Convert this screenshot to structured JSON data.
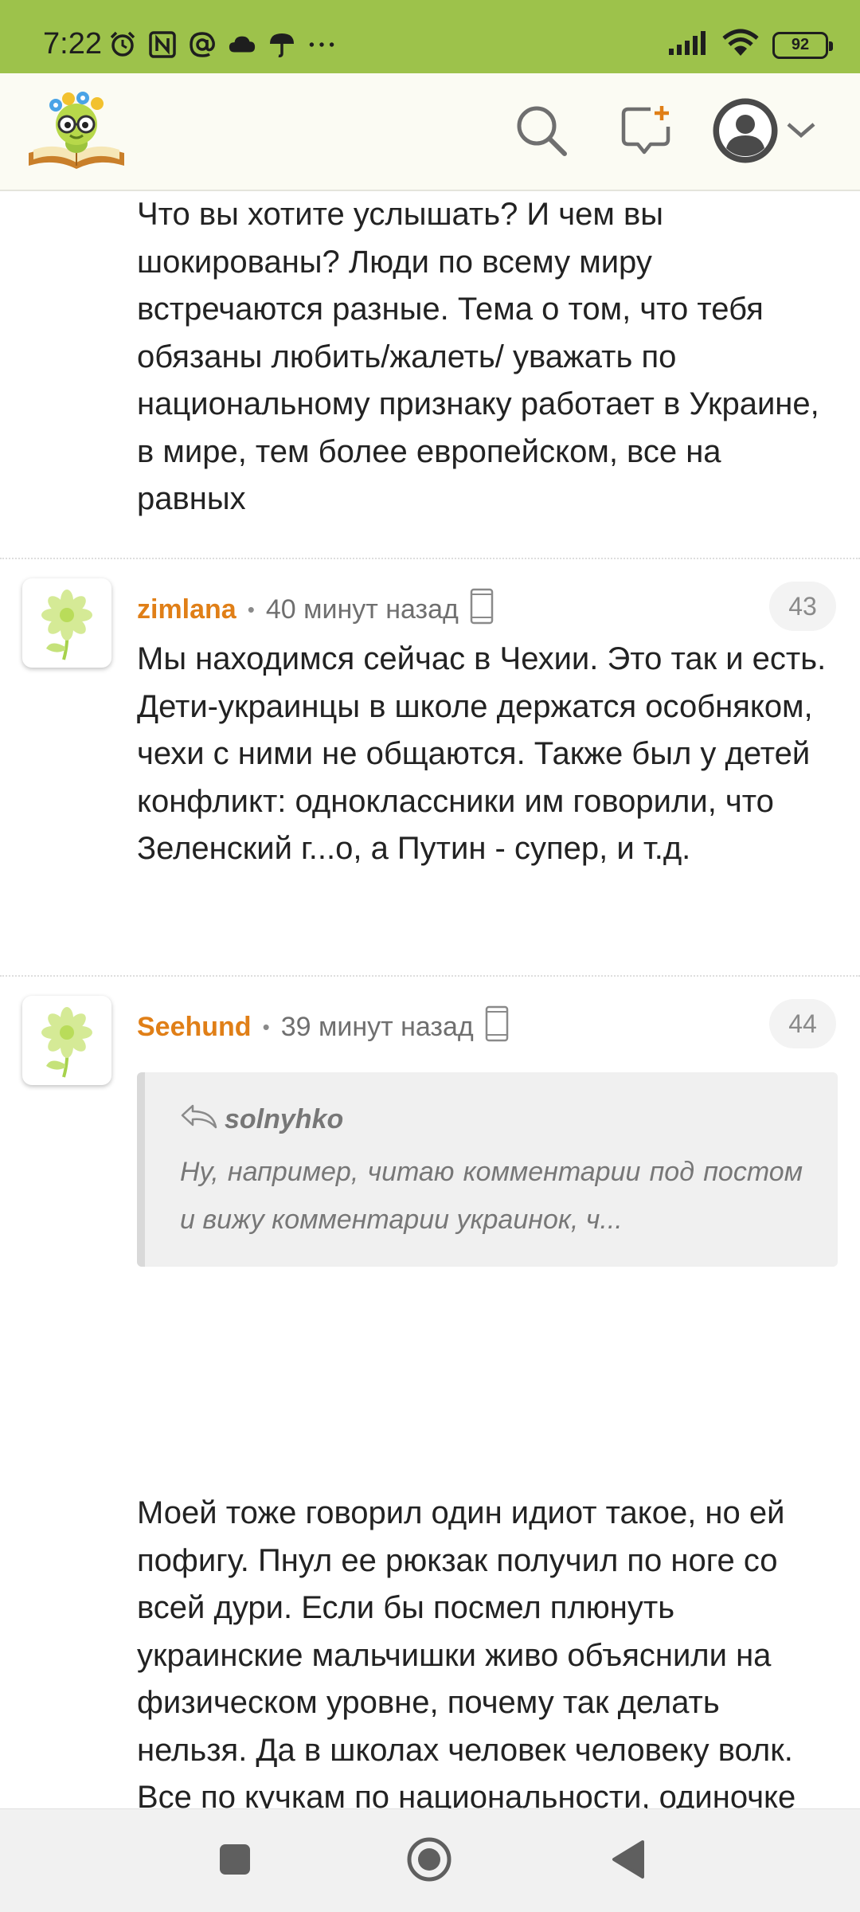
{
  "status_bar": {
    "time": "7:22",
    "battery": "92",
    "icons": [
      "alarm-icon",
      "nfc-icon",
      "at-icon",
      "cloud-icon",
      "umbrella-icon",
      "more-icon",
      "signal-icon",
      "wifi-icon",
      "battery-icon"
    ]
  },
  "header": {
    "icons": [
      "logo",
      "search-icon",
      "new-post-icon",
      "profile-icon",
      "chevron-down-icon"
    ],
    "colors": {
      "bar": "#fbfbf3",
      "status": "#9dc24b",
      "accent": "#e07f17"
    }
  },
  "comments": [
    {
      "text": "Что вы хотите услышать? И чем вы шокированы? Люди по всему миру встречаются разные. Тема о том, что тебя обязаны любить/жалеть/ уважать по национальному признаку работает в Украине, в мире, тем более европейском, все на равных"
    },
    {
      "author": "zimlana",
      "separator": "•",
      "time": "40 минут назад",
      "number": "43",
      "text": "Мы находимся сейчас в Чехии. Это так и есть. Дети-украинцы в школе держатся особняком, чехи с ними не общаются. Также был у детей конфликт: одноклассники им говорили, что Зеленский г...о, а Путин - супер, и т.д."
    },
    {
      "author": "Seehund",
      "separator": "•",
      "time": "39 минут назад",
      "number": "44",
      "quote": {
        "author": "solnyhko",
        "text": "Ну, например, читаю комментарии под постом и вижу комментарии украинок, ч..."
      },
      "text": "Моей тоже говорил один идиот такое, но ей пофигу. Пнул ее рюкзак получил по ноге со всей дури. Если бы посмел плюнуть украинские мальчишки живо объяснили на физическом уровне, почему так делать нельзя. Да в школах человек человеку волк. Все по кучкам по национальности, одиночке не выжить, любой кстати национальности. Очень смешно звучит в этом контексте девиз школы - против рассизма. Германия."
    }
  ],
  "nav": {
    "icons": [
      "recents-square-icon",
      "home-circle-icon",
      "back-triangle-icon"
    ]
  }
}
